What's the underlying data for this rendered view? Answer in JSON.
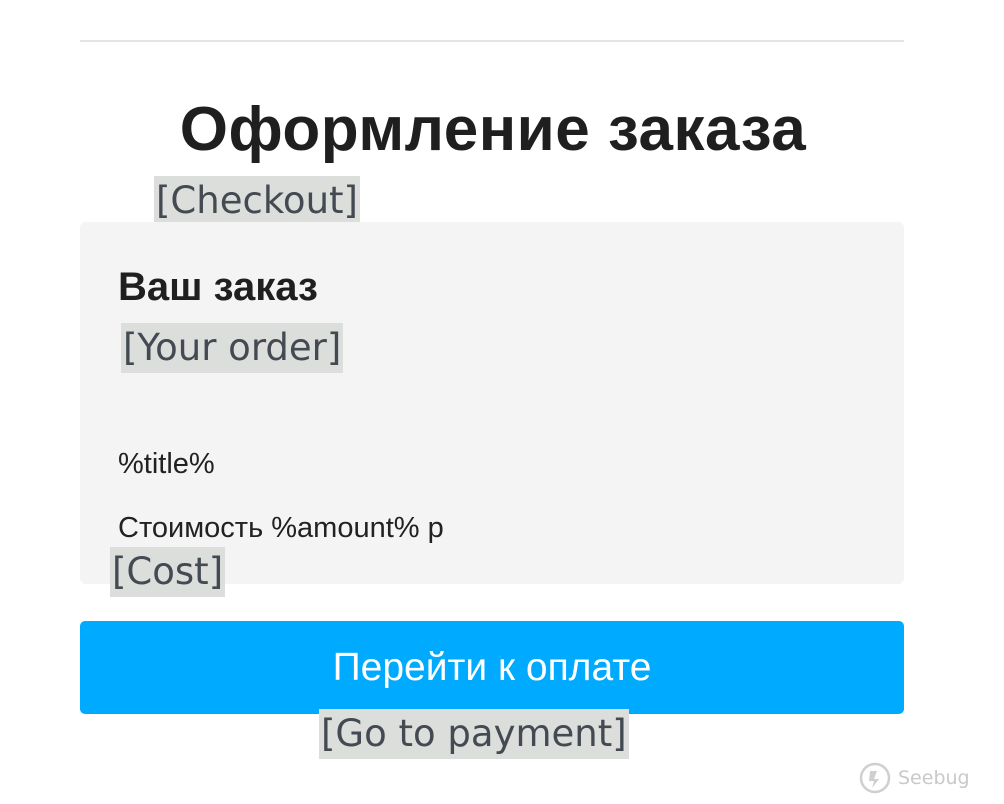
{
  "header": {
    "title": "Оформление заказа",
    "title_translation": "[Checkout]"
  },
  "order": {
    "heading": "Ваш заказ",
    "heading_translation": "[Your order]",
    "item_title": "%title%",
    "cost_line": "Стоимость %amount% р",
    "cost_translation": "[Cost]"
  },
  "actions": {
    "pay_label": "Перейти к оплате",
    "pay_translation": "[Go to payment]",
    "pay_color": "#00aaff"
  },
  "watermark": {
    "text": "Seebug",
    "icon": "seebug-logo-icon"
  }
}
